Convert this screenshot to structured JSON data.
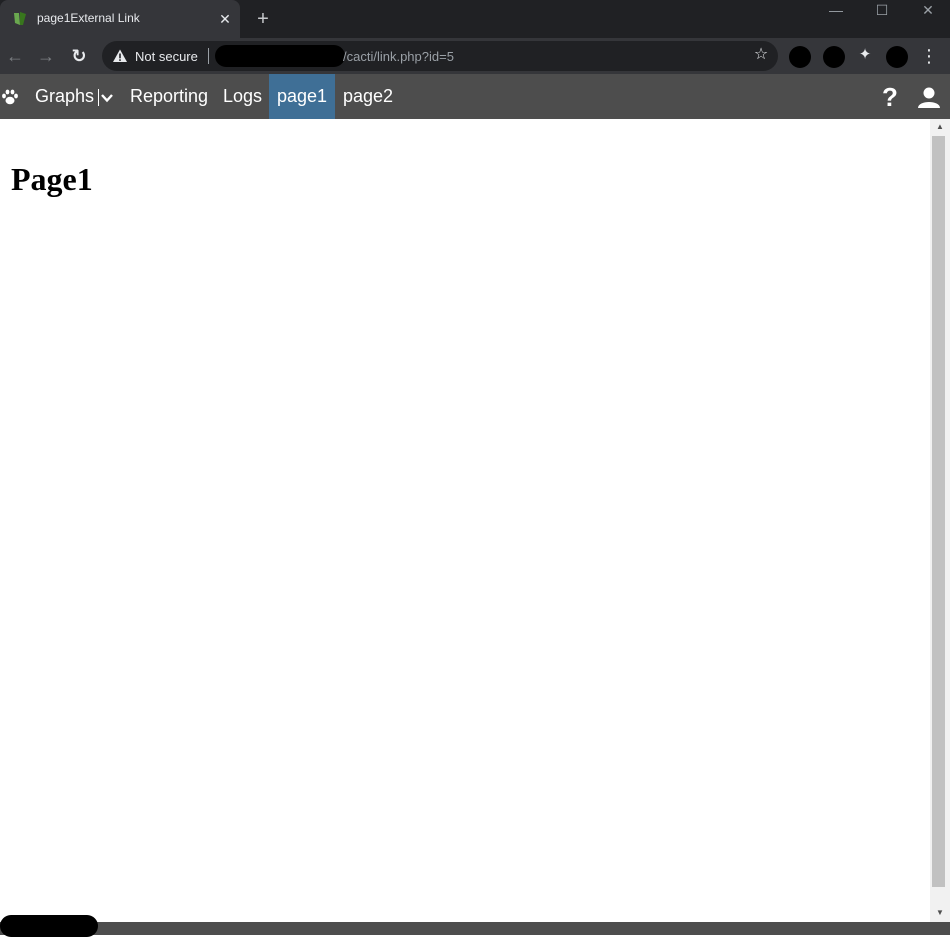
{
  "browser": {
    "tab_title": "page1External Link",
    "close_glyph": "✕",
    "newtab_glyph": "+",
    "security_label": "Not secure",
    "url_path": "/cacti/link.php?id=5",
    "star_glyph": "☆",
    "puzzle_glyph": "✦",
    "kebab_glyph": "⋮",
    "back_glyph": "←",
    "forward_glyph": "→",
    "reload_glyph": "↻",
    "minimize_glyph": "—",
    "maximize_glyph": "☐",
    "window_close_glyph": "✕"
  },
  "nav": {
    "items": [
      {
        "label": "Graphs"
      },
      {
        "label": "Reporting"
      },
      {
        "label": "Logs"
      },
      {
        "label": "page1",
        "active": true
      },
      {
        "label": "page2"
      }
    ],
    "help_glyph": "?"
  },
  "main": {
    "heading": "Page1"
  },
  "scroll": {
    "up_glyph": "▲",
    "down_glyph": "▼"
  },
  "colors": {
    "nav_bg": "#4d4d4d",
    "nav_active": "#3f6f96",
    "chrome_dark": "#202124",
    "chrome_toolbar": "#35363a"
  }
}
